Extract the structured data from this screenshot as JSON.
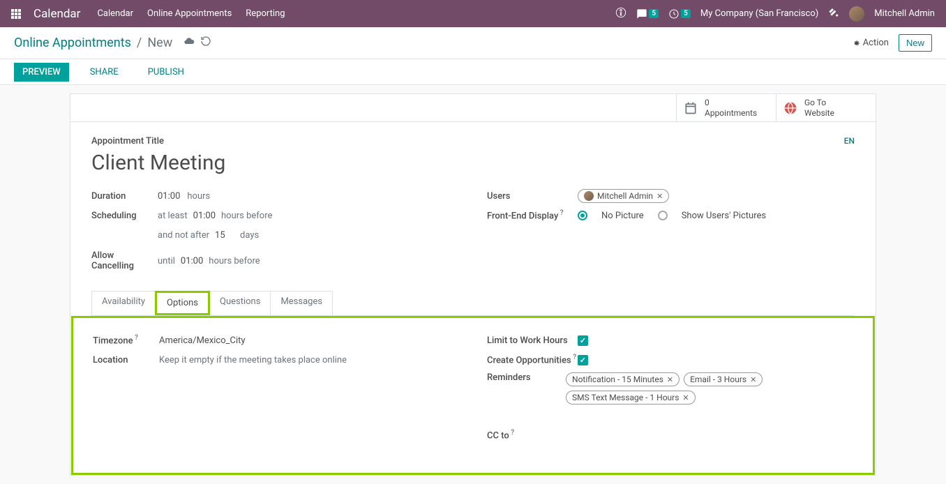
{
  "topbar": {
    "brand": "Calendar",
    "nav": [
      "Calendar",
      "Online Appointments",
      "Reporting"
    ],
    "msg_count": "5",
    "clock_count": "5",
    "company": "My Company (San Francisco)",
    "user": "Mitchell Admin"
  },
  "subheader": {
    "crumb_root": "Online Appointments",
    "crumb_current": "New",
    "action": "Action",
    "new_btn": "New"
  },
  "tabbar": {
    "preview": "PREVIEW",
    "share": "SHARE",
    "publish": "PUBLISH"
  },
  "stats": {
    "appt_count": "0",
    "appt_label": "Appointments",
    "goto_line1": "Go To",
    "goto_line2": "Website"
  },
  "form": {
    "title_label": "Appointment Title",
    "title_value": "Client Meeting",
    "lang": "EN",
    "duration_label": "Duration",
    "duration_val": "01:00",
    "duration_unit": "hours",
    "sched_label": "Scheduling",
    "sched_at_least": "at least",
    "sched_at_least_val": "01:00",
    "sched_unit1": "hours before",
    "sched_not_after": "and not after",
    "sched_not_after_val": "15",
    "sched_unit2": "days",
    "cancel_label": "Allow Cancelling",
    "cancel_until": "until",
    "cancel_val": "01:00",
    "cancel_unit": "hours before",
    "users_label": "Users",
    "user_tag": "Mitchell Admin",
    "frontend_label": "Front-End Display",
    "radio_no_pic": "No Picture",
    "radio_show_pics": "Show Users' Pictures"
  },
  "inner_tabs": {
    "availability": "Availability",
    "options": "Options",
    "questions": "Questions",
    "messages": "Messages"
  },
  "options": {
    "tz_label": "Timezone",
    "tz_val": "America/Mexico_City",
    "loc_label": "Location",
    "loc_placeholder": "Keep it empty if the meeting takes place online",
    "limit_label": "Limit to Work Hours",
    "create_opp_label": "Create Opportunities",
    "reminders_label": "Reminders",
    "reminder_tags": [
      "Notification - 15 Minutes",
      "Email - 3 Hours",
      "SMS Text Message - 1 Hours"
    ],
    "cc_label": "CC to"
  }
}
